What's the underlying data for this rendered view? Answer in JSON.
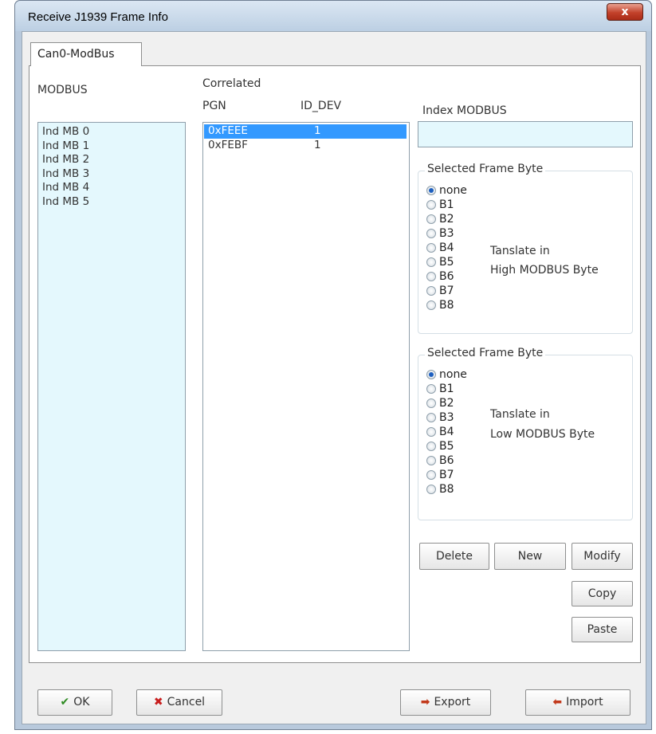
{
  "window": {
    "title": "Receive J1939 Frame Info",
    "close_glyph": "x"
  },
  "tab": {
    "label": "Can0-ModBus"
  },
  "modbus": {
    "label": "MODBUS",
    "items": [
      "Ind MB 0",
      "Ind MB 1",
      "Ind MB 2",
      "Ind MB 3",
      "Ind MB 4",
      "Ind MB 5"
    ]
  },
  "correlated": {
    "label": "Correlated",
    "col_pgn": "PGN",
    "col_id_dev": "ID_DEV",
    "rows": [
      {
        "pgn": "0xFEEE",
        "id_dev": "1",
        "selected": true
      },
      {
        "pgn": "0xFEBF",
        "id_dev": "1",
        "selected": false
      }
    ]
  },
  "index_modbus": {
    "label": "Index MODBUS",
    "value": ""
  },
  "high_group": {
    "title": "Selected Frame Byte",
    "options": [
      "none",
      "B1",
      "B2",
      "B3",
      "B4",
      "B5",
      "B6",
      "B7",
      "B8"
    ],
    "selected": "none",
    "note_line1": "Tanslate in",
    "note_line2": "High MODBUS Byte"
  },
  "low_group": {
    "title": "Selected Frame Byte",
    "options": [
      "none",
      "B1",
      "B2",
      "B3",
      "B4",
      "B5",
      "B6",
      "B7",
      "B8"
    ],
    "selected": "none",
    "note_line1": "Tanslate in",
    "note_line2": "Low MODBUS Byte"
  },
  "buttons": {
    "delete": "Delete",
    "new": "New",
    "modify": "Modify",
    "copy": "Copy",
    "paste": "Paste",
    "ok": "OK",
    "cancel": "Cancel",
    "export": "Export",
    "import": "Import"
  },
  "icons": {
    "ok": "check-icon",
    "cancel": "cross-icon",
    "export": "export-icon",
    "import": "import-icon"
  },
  "colors": {
    "ok_icon": "#2e8b22",
    "cancel_icon": "#c81e1e",
    "selection": "#3399ff",
    "list_background": "#e4f8fd"
  }
}
